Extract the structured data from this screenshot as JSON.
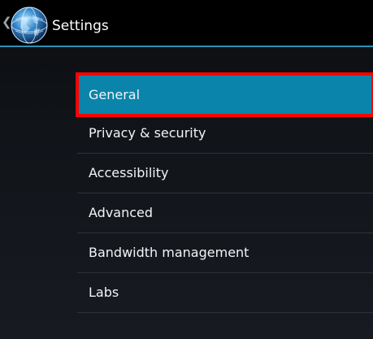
{
  "action_bar": {
    "title": "Settings",
    "back_glyph": "❮",
    "app_icon": "globe-app-icon"
  },
  "settings": {
    "items": [
      {
        "label": "General",
        "selected": true
      },
      {
        "label": "Privacy & security",
        "selected": false
      },
      {
        "label": "Accessibility",
        "selected": false
      },
      {
        "label": "Advanced",
        "selected": false
      },
      {
        "label": "Bandwidth management",
        "selected": false
      },
      {
        "label": "Labs",
        "selected": false
      }
    ]
  },
  "colors": {
    "accent_line": "#2e8fb5",
    "selected_background": "#0a84aa",
    "highlight_outline": "#ff0000"
  }
}
